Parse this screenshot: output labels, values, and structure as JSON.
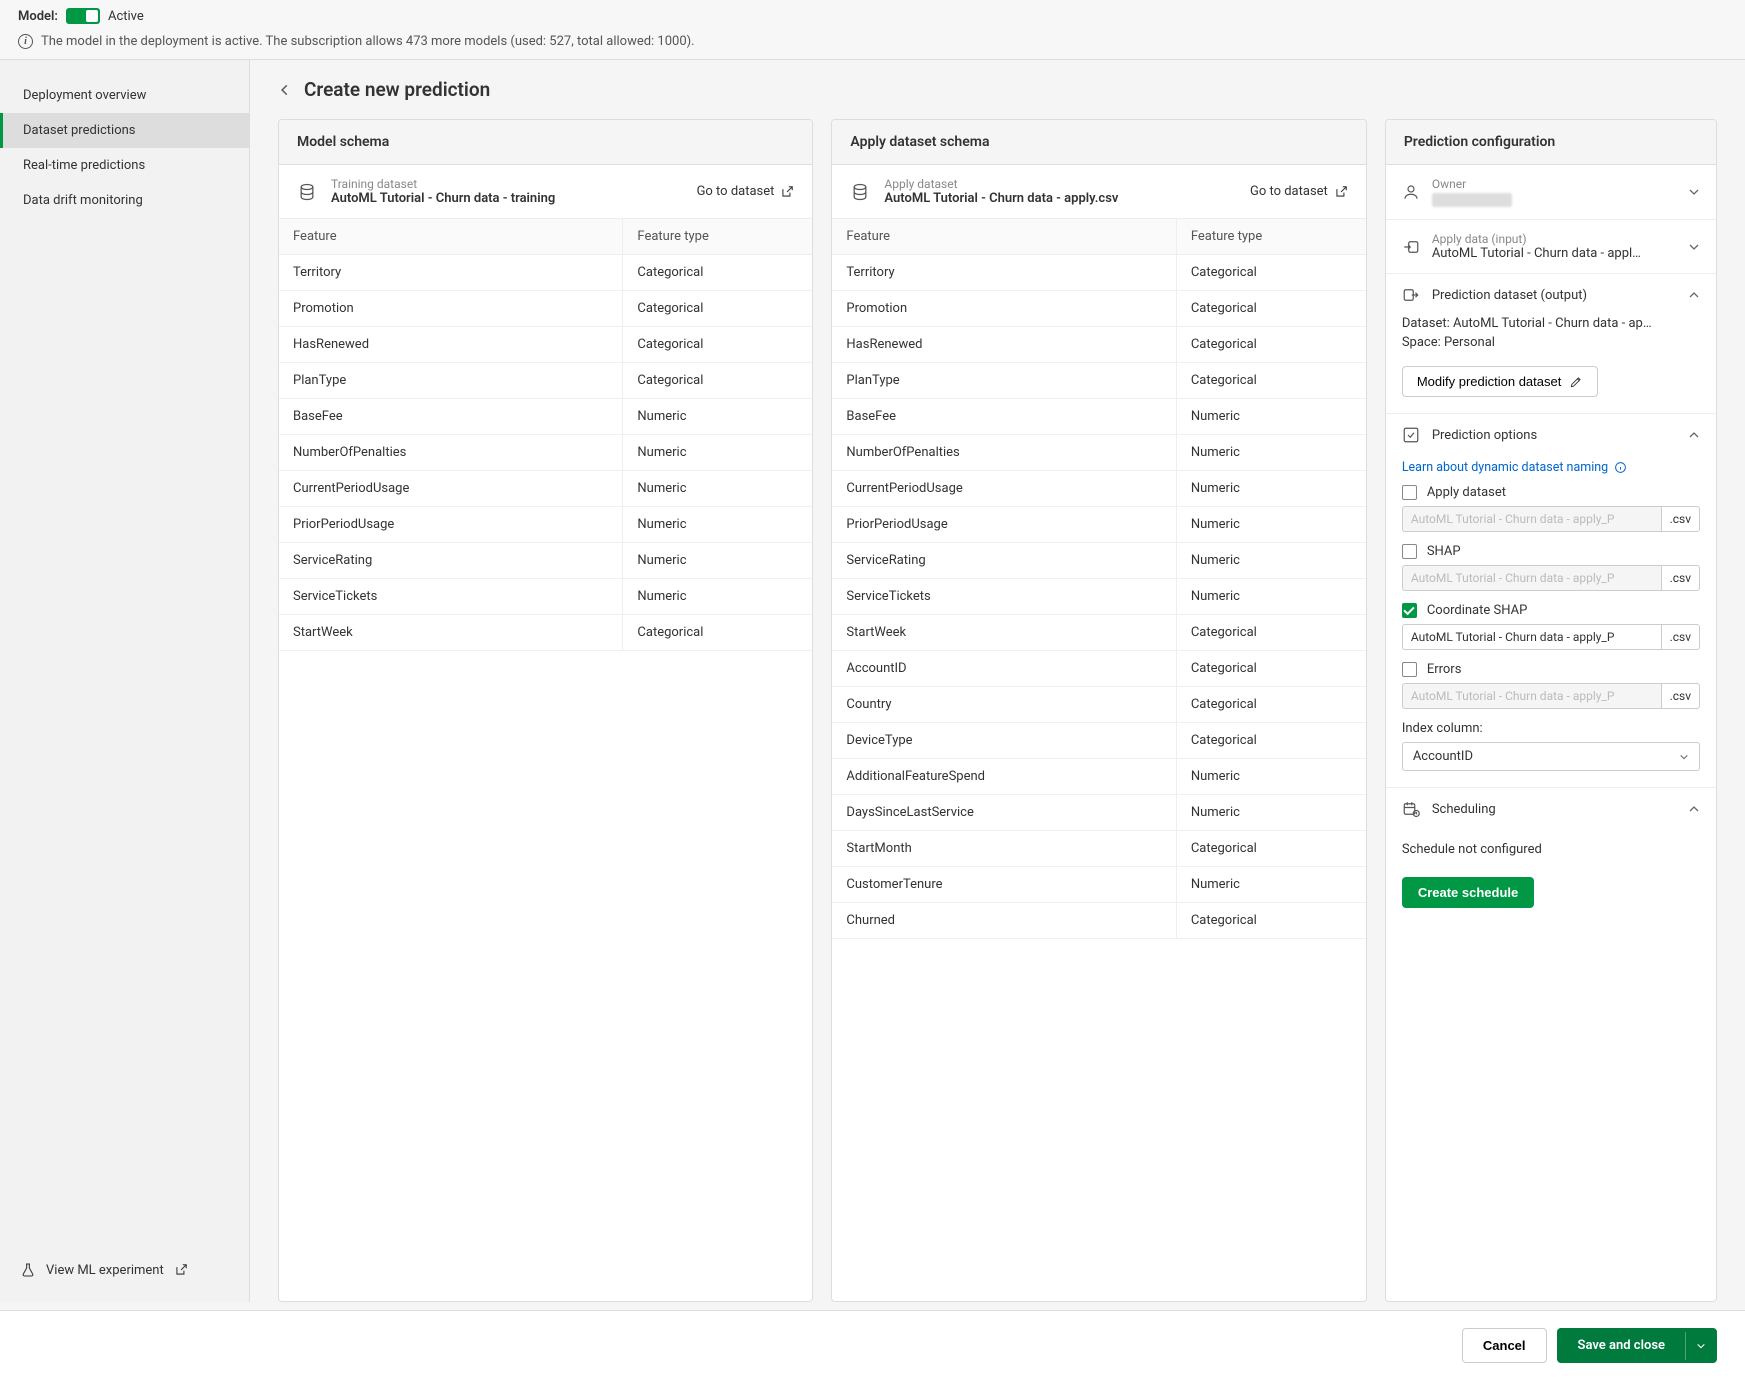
{
  "banner": {
    "model_label": "Model:",
    "toggle_state": "Active",
    "info_text": "The model in the deployment is active. The subscription allows 473 more models (used: 527, total allowed: 1000)."
  },
  "sidebar": {
    "items": [
      {
        "label": "Deployment overview",
        "active": false
      },
      {
        "label": "Dataset predictions",
        "active": true
      },
      {
        "label": "Real-time predictions",
        "active": false
      },
      {
        "label": "Data drift monitoring",
        "active": false
      }
    ],
    "experiment_link": "View ML experiment"
  },
  "page_title": "Create new prediction",
  "model_schema": {
    "title": "Model schema",
    "dataset_sub": "Training dataset",
    "dataset_name": "AutoML Tutorial - Churn data - training",
    "goto": "Go to dataset",
    "col_feature": "Feature",
    "col_type": "Feature type",
    "rows": [
      {
        "feature": "Territory",
        "type": "Categorical"
      },
      {
        "feature": "Promotion",
        "type": "Categorical"
      },
      {
        "feature": "HasRenewed",
        "type": "Categorical"
      },
      {
        "feature": "PlanType",
        "type": "Categorical"
      },
      {
        "feature": "BaseFee",
        "type": "Numeric"
      },
      {
        "feature": "NumberOfPenalties",
        "type": "Numeric"
      },
      {
        "feature": "CurrentPeriodUsage",
        "type": "Numeric"
      },
      {
        "feature": "PriorPeriodUsage",
        "type": "Numeric"
      },
      {
        "feature": "ServiceRating",
        "type": "Numeric"
      },
      {
        "feature": "ServiceTickets",
        "type": "Numeric"
      },
      {
        "feature": "StartWeek",
        "type": "Categorical"
      }
    ]
  },
  "apply_schema": {
    "title": "Apply dataset schema",
    "dataset_sub": "Apply dataset",
    "dataset_name": "AutoML Tutorial - Churn data - apply.csv",
    "goto": "Go to dataset",
    "col_feature": "Feature",
    "col_type": "Feature type",
    "rows": [
      {
        "feature": "Territory",
        "type": "Categorical"
      },
      {
        "feature": "Promotion",
        "type": "Categorical"
      },
      {
        "feature": "HasRenewed",
        "type": "Categorical"
      },
      {
        "feature": "PlanType",
        "type": "Categorical"
      },
      {
        "feature": "BaseFee",
        "type": "Numeric"
      },
      {
        "feature": "NumberOfPenalties",
        "type": "Numeric"
      },
      {
        "feature": "CurrentPeriodUsage",
        "type": "Numeric"
      },
      {
        "feature": "PriorPeriodUsage",
        "type": "Numeric"
      },
      {
        "feature": "ServiceRating",
        "type": "Numeric"
      },
      {
        "feature": "ServiceTickets",
        "type": "Numeric"
      },
      {
        "feature": "StartWeek",
        "type": "Categorical"
      },
      {
        "feature": "AccountID",
        "type": "Categorical"
      },
      {
        "feature": "Country",
        "type": "Categorical"
      },
      {
        "feature": "DeviceType",
        "type": "Categorical"
      },
      {
        "feature": "AdditionalFeatureSpend",
        "type": "Numeric"
      },
      {
        "feature": "DaysSinceLastService",
        "type": "Numeric"
      },
      {
        "feature": "StartMonth",
        "type": "Categorical"
      },
      {
        "feature": "CustomerTenure",
        "type": "Numeric"
      },
      {
        "feature": "Churned",
        "type": "Categorical"
      }
    ]
  },
  "config": {
    "title": "Prediction configuration",
    "owner": {
      "label": "Owner"
    },
    "apply_data": {
      "label": "Apply data (input)",
      "value": "AutoML Tutorial - Churn data - appl…"
    },
    "output": {
      "label": "Prediction dataset (output)",
      "dataset_line": "Dataset: AutoML Tutorial - Churn data - ap…",
      "space_line": "Space: Personal",
      "modify_btn": "Modify prediction dataset"
    },
    "options": {
      "label": "Prediction options",
      "learn_link": "Learn about dynamic dataset naming",
      "items": [
        {
          "label": "Apply dataset",
          "checked": false,
          "value": "AutoML Tutorial - Churn data - apply_P",
          "ext": ".csv"
        },
        {
          "label": "SHAP",
          "checked": false,
          "value": "AutoML Tutorial - Churn data - apply_P",
          "ext": ".csv"
        },
        {
          "label": "Coordinate SHAP",
          "checked": true,
          "value": "AutoML Tutorial - Churn data - apply_P",
          "ext": ".csv"
        },
        {
          "label": "Errors",
          "checked": false,
          "value": "AutoML Tutorial - Churn data - apply_P",
          "ext": ".csv"
        }
      ],
      "index_label": "Index column:",
      "index_value": "AccountID"
    },
    "scheduling": {
      "label": "Scheduling",
      "status": "Schedule not configured",
      "btn": "Create schedule"
    }
  },
  "footer": {
    "cancel": "Cancel",
    "save": "Save and close"
  }
}
